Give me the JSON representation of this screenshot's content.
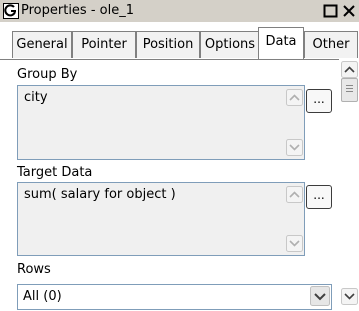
{
  "window": {
    "title": "Properties - ole_1"
  },
  "tabs": [
    {
      "label": "General"
    },
    {
      "label": "Pointer"
    },
    {
      "label": "Position"
    },
    {
      "label": "Options"
    },
    {
      "label": "Data"
    },
    {
      "label": "Other"
    }
  ],
  "active_tab": "Data",
  "group_by": {
    "label": "Group By",
    "value": "city",
    "button": "..."
  },
  "target_data": {
    "label": "Target Data",
    "value": "sum(  salary  for object )",
    "button": "..."
  },
  "rows": {
    "label": "Rows",
    "value": "All (0)"
  },
  "colors": {
    "titlebar": "#d4d0c8",
    "field_border": "#7f9db9",
    "field_bg": "#f0f0f0"
  }
}
